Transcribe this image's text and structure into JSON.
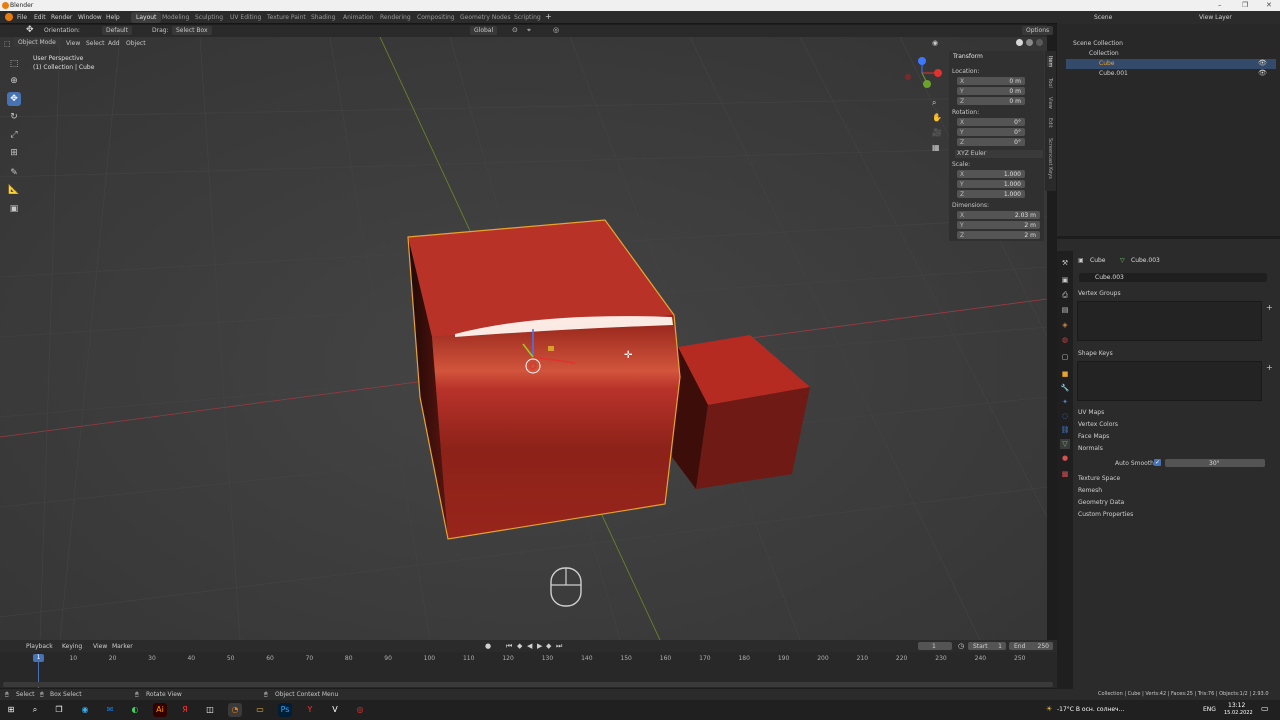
{
  "window": {
    "title": "Blender",
    "controls": [
      "–",
      "❐",
      "✕"
    ]
  },
  "menus": [
    "File",
    "Edit",
    "Render",
    "Window",
    "Help"
  ],
  "workspaces": [
    "Layout",
    "Modeling",
    "Sculpting",
    "UV Editing",
    "Texture Paint",
    "Shading",
    "Animation",
    "Rendering",
    "Compositing",
    "Geometry Nodes",
    "Scripting"
  ],
  "active_workspace": "Layout",
  "add_workspace": "+",
  "scene": {
    "label": "Scene",
    "view_layer": "View Layer"
  },
  "viewport_header": {
    "orientation_label": "Orientation:",
    "orientation_value": "Default",
    "drag_label": "Drag:",
    "drag_value": "Select Box",
    "transform_orientation": "Global",
    "mode": "Object Mode",
    "view_menus": [
      "View",
      "Select",
      "Add",
      "Object"
    ],
    "options": "Options"
  },
  "viewport_info": {
    "line1": "User Perspective",
    "line2": "(1) Collection | Cube"
  },
  "npanel": {
    "title": "Transform",
    "location_label": "Location:",
    "location": [
      {
        "axis": "X",
        "value": "0 m"
      },
      {
        "axis": "Y",
        "value": "0 m"
      },
      {
        "axis": "Z",
        "value": "0 m"
      }
    ],
    "rotation_label": "Rotation:",
    "rotation": [
      {
        "axis": "X",
        "value": "0°"
      },
      {
        "axis": "Y",
        "value": "0°"
      },
      {
        "axis": "Z",
        "value": "0°"
      }
    ],
    "rotation_mode": "XYZ Euler",
    "scale_label": "Scale:",
    "scale": [
      {
        "axis": "X",
        "value": "1.000"
      },
      {
        "axis": "Y",
        "value": "1.000"
      },
      {
        "axis": "Z",
        "value": "1.000"
      }
    ],
    "dimensions_label": "Dimensions:",
    "dimensions": [
      {
        "axis": "X",
        "value": "2.03 m"
      },
      {
        "axis": "Y",
        "value": "2 m"
      },
      {
        "axis": "Z",
        "value": "2 m"
      }
    ],
    "tabs": [
      "Item",
      "Tool",
      "View",
      "Edit",
      "Screencast Keys"
    ]
  },
  "outliner": {
    "root": "Scene Collection",
    "collection": "Collection",
    "items": [
      {
        "name": "Cube",
        "selected": true
      },
      {
        "name": "Cube.001",
        "selected": false
      }
    ]
  },
  "properties": {
    "object": "Cube",
    "mesh": "Cube.003",
    "mesh_field": "Cube.003",
    "sections_top": [
      "Vertex Groups",
      "Shape Keys"
    ],
    "sections_mid": [
      "UV Maps",
      "Vertex Colors",
      "Face Maps",
      "Normals"
    ],
    "auto_smooth_label": "Auto Smooth",
    "auto_smooth_angle": "30°",
    "sections_bottom": [
      "Texture Space",
      "Remesh",
      "Geometry Data",
      "Custom Properties"
    ]
  },
  "timeline": {
    "menus": [
      "Playback",
      "Keying",
      "View",
      "Marker"
    ],
    "current_frame": "1",
    "start_label": "Start",
    "start": "1",
    "end_label": "End",
    "end": "250",
    "ticks": [
      "10",
      "20",
      "30",
      "40",
      "50",
      "60",
      "70",
      "80",
      "90",
      "100",
      "110",
      "120",
      "130",
      "140",
      "150",
      "160",
      "170",
      "180",
      "190",
      "200",
      "210",
      "220",
      "230",
      "240",
      "250"
    ],
    "playhead": "1"
  },
  "statusbar": {
    "select": "Select",
    "box_select": "Box Select",
    "rotate_view": "Rotate View",
    "context_menu": "Object Context Menu",
    "stats": "Collection | Cube | Verts:42 | Faces:25 | Tris:76 | Objects:1/2 | 2.93.0"
  },
  "taskbar": {
    "weather": "-17°C В осн. солнеч...",
    "lang": "ENG",
    "time": "13:12",
    "date": "15.02.2022"
  },
  "colors": {
    "accent": "#4772b3",
    "selection_outline": "#e8a32f",
    "cube_red": "#b8291f"
  }
}
